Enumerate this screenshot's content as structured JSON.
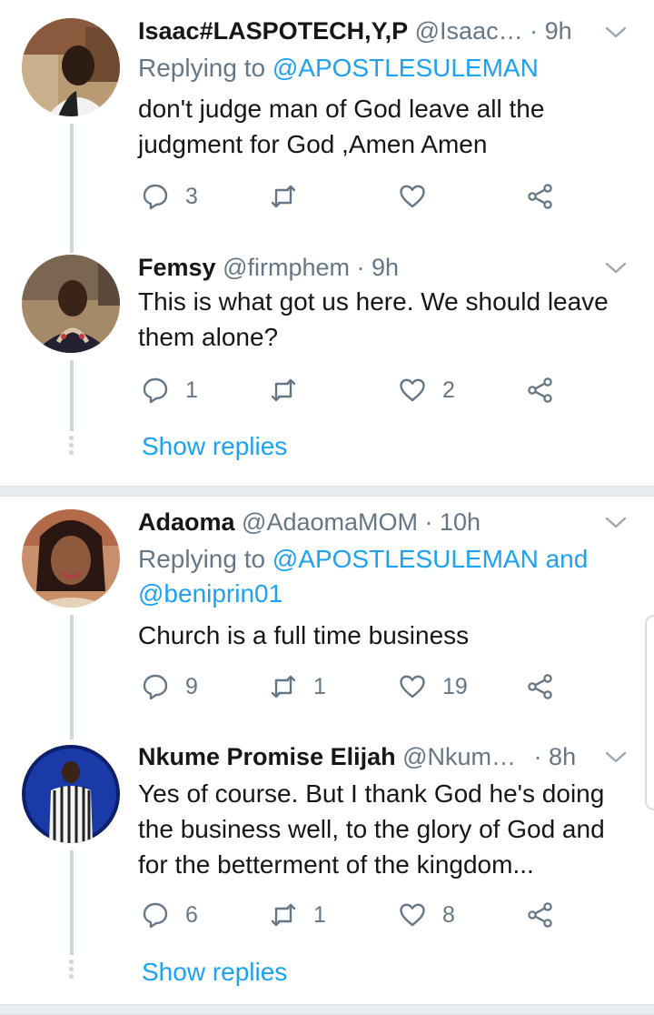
{
  "colors": {
    "accent": "#1da1f2",
    "muted": "#657786",
    "text": "#14171a",
    "line": "#ccd6dd"
  },
  "icons": {
    "reply": "reply-bubble-icon",
    "retweet": "retweet-icon",
    "like": "heart-icon",
    "share": "share-icon",
    "menu": "chevron-down-icon"
  },
  "tweets": [
    {
      "name": "Isaac#LASPOTECH,Y,P",
      "handle": "@Isaac…",
      "time": "· 9h",
      "replying_prefix": "Replying to ",
      "replying_to": "@APOSTLESULEMAN",
      "replying_extra": "",
      "text": "don't judge man of God leave all the judgment for God ,Amen Amen",
      "replies": "3",
      "retweets": "",
      "likes": ""
    },
    {
      "name": "Femsy",
      "handle": "@firmphem",
      "time": "· 9h",
      "text": "This is what got us here. We should leave them alone?",
      "replies": "1",
      "retweets": "",
      "likes": "2",
      "show_replies": "Show replies"
    },
    {
      "name": "Adaoma",
      "handle": "@AdaomaMOM",
      "time": "· 10h",
      "replying_prefix": "Replying to ",
      "replying_to": "@APOSTLESULEMAN",
      "replying_and": " and",
      "replying_extra": "@beniprin01",
      "text": "Church is a full time business",
      "replies": "9",
      "retweets": "1",
      "likes": "19"
    },
    {
      "name": "Nkume Promise Elijah",
      "handle": "@Nkum…",
      "time": "· 8h",
      "text": "Yes of course. But I thank God he's doing the business well, to the glory of God and for the betterment of the kingdom...",
      "replies": "6",
      "retweets": "1",
      "likes": "8",
      "show_replies": "Show replies"
    }
  ]
}
